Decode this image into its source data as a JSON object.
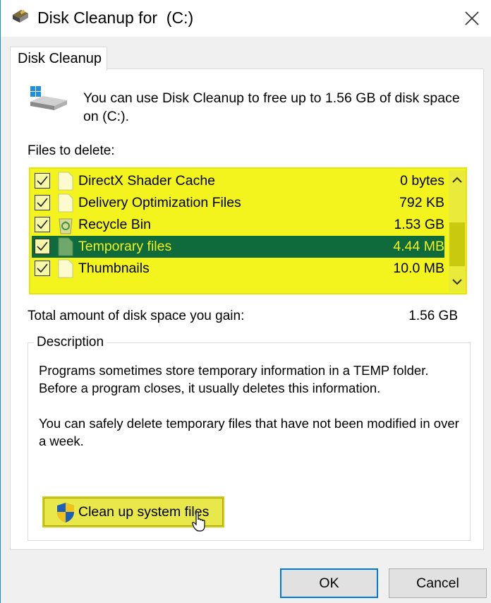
{
  "window": {
    "title": "Disk Cleanup for  (C:)"
  },
  "tab": {
    "label": "Disk Cleanup"
  },
  "intro": {
    "text": "You can use Disk Cleanup to free up to 1.56 GB of disk space on  (C:)."
  },
  "files": {
    "label": "Files to delete:",
    "items": [
      {
        "name": "DirectX Shader Cache",
        "size": "0 bytes",
        "checked": true,
        "selected": false,
        "icon": "file-icon"
      },
      {
        "name": "Delivery Optimization Files",
        "size": "792 KB",
        "checked": true,
        "selected": false,
        "icon": "file-icon"
      },
      {
        "name": "Recycle Bin",
        "size": "1.53 GB",
        "checked": true,
        "selected": false,
        "icon": "recycle-bin-icon"
      },
      {
        "name": "Temporary files",
        "size": "4.44 MB",
        "checked": true,
        "selected": true,
        "icon": "file-icon"
      },
      {
        "name": "Thumbnails",
        "size": "10.0 MB",
        "checked": true,
        "selected": false,
        "icon": "file-icon"
      }
    ]
  },
  "total": {
    "label": "Total amount of disk space you gain:",
    "value": "1.56 GB"
  },
  "description": {
    "legend": "Description",
    "paragraph1": "Programs sometimes store temporary information in a TEMP folder. Before a program closes, it usually deletes this information.",
    "paragraph2": "You can safely delete temporary files that have not been modified in over a week."
  },
  "buttons": {
    "cleanup_system": "Clean up system files",
    "ok": "OK",
    "cancel": "Cancel"
  },
  "colors": {
    "highlight": "#f3f31e",
    "selected_row": "#0f6b3c",
    "ok_border": "#0078d7"
  }
}
